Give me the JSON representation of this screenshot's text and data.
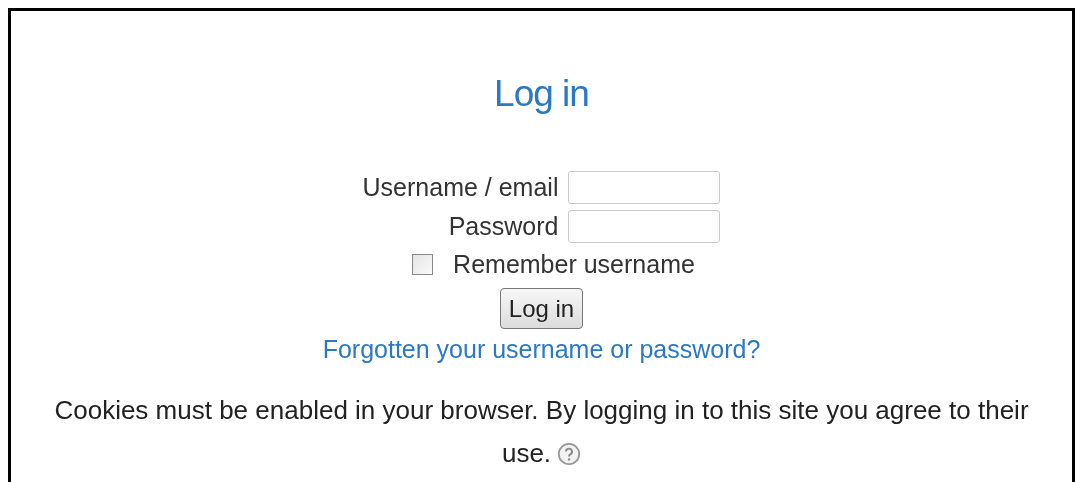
{
  "title": "Log in",
  "fields": [
    {
      "label": "Username / email"
    },
    {
      "label": "Password"
    }
  ],
  "remember": {
    "label": "Remember username",
    "checked": false
  },
  "button": "Log in",
  "forgot_link": "Forgotten your username or password?",
  "cookies_notice": "Cookies must be enabled in your browser. By logging in to this site you agree to their use."
}
